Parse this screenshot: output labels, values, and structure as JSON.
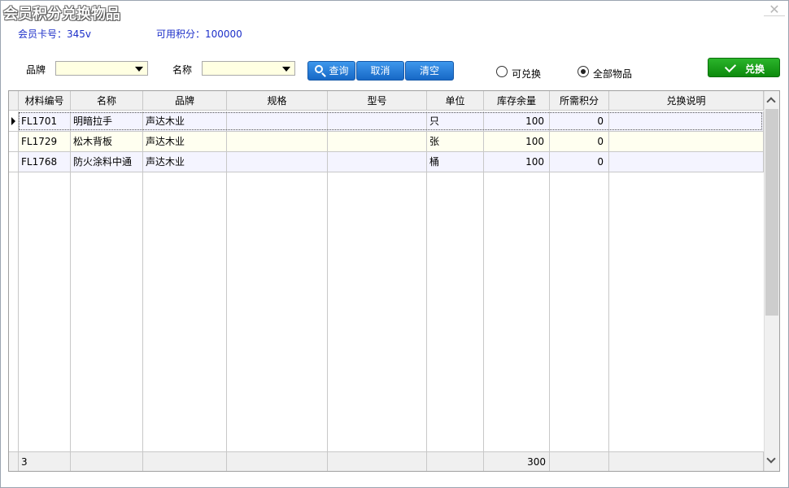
{
  "window": {
    "title": "会员积分兑换物品",
    "close_glyph": "✕"
  },
  "info": {
    "card_label": "会员卡号：345v",
    "points_label": "可用积分：100000"
  },
  "filters": {
    "brand_label": "品牌",
    "brand_value": "",
    "name_label": "名称",
    "name_value": ""
  },
  "buttons": {
    "search": "查询",
    "cancel": "取消",
    "clear": "清空",
    "exchange": "兑换"
  },
  "radio": {
    "exchangeable": "可兑换",
    "all": "全部物品",
    "selected": "all"
  },
  "grid": {
    "columns": [
      "材料编号",
      "名称",
      "品牌",
      "规格",
      "型号",
      "单位",
      "库存余量",
      "所需积分",
      "兑换说明"
    ],
    "rows": [
      {
        "code": "FL1701",
        "name": "明暗拉手",
        "brand": "声达木业",
        "spec": "",
        "model": "",
        "unit": "只",
        "stock": "100",
        "points": "0",
        "note": ""
      },
      {
        "code": "FL1729",
        "name": "松木背板",
        "brand": "声达木业",
        "spec": "",
        "model": "",
        "unit": "张",
        "stock": "100",
        "points": "0",
        "note": ""
      },
      {
        "code": "FL1768",
        "name": "防火涂料中通",
        "brand": "声达木业",
        "spec": "",
        "model": "",
        "unit": "桶",
        "stock": "100",
        "points": "0",
        "note": ""
      }
    ],
    "footer": {
      "count": "3",
      "stock_total": "300"
    }
  },
  "colors": {
    "info_text": "#1c2fc9",
    "combo_bg": "#ffffe2",
    "row_alt_even": "#f4f4ff",
    "row_alt_odd": "#fffff0",
    "accent_blue": "#1e74d6",
    "accent_green": "#0d8a0d"
  }
}
